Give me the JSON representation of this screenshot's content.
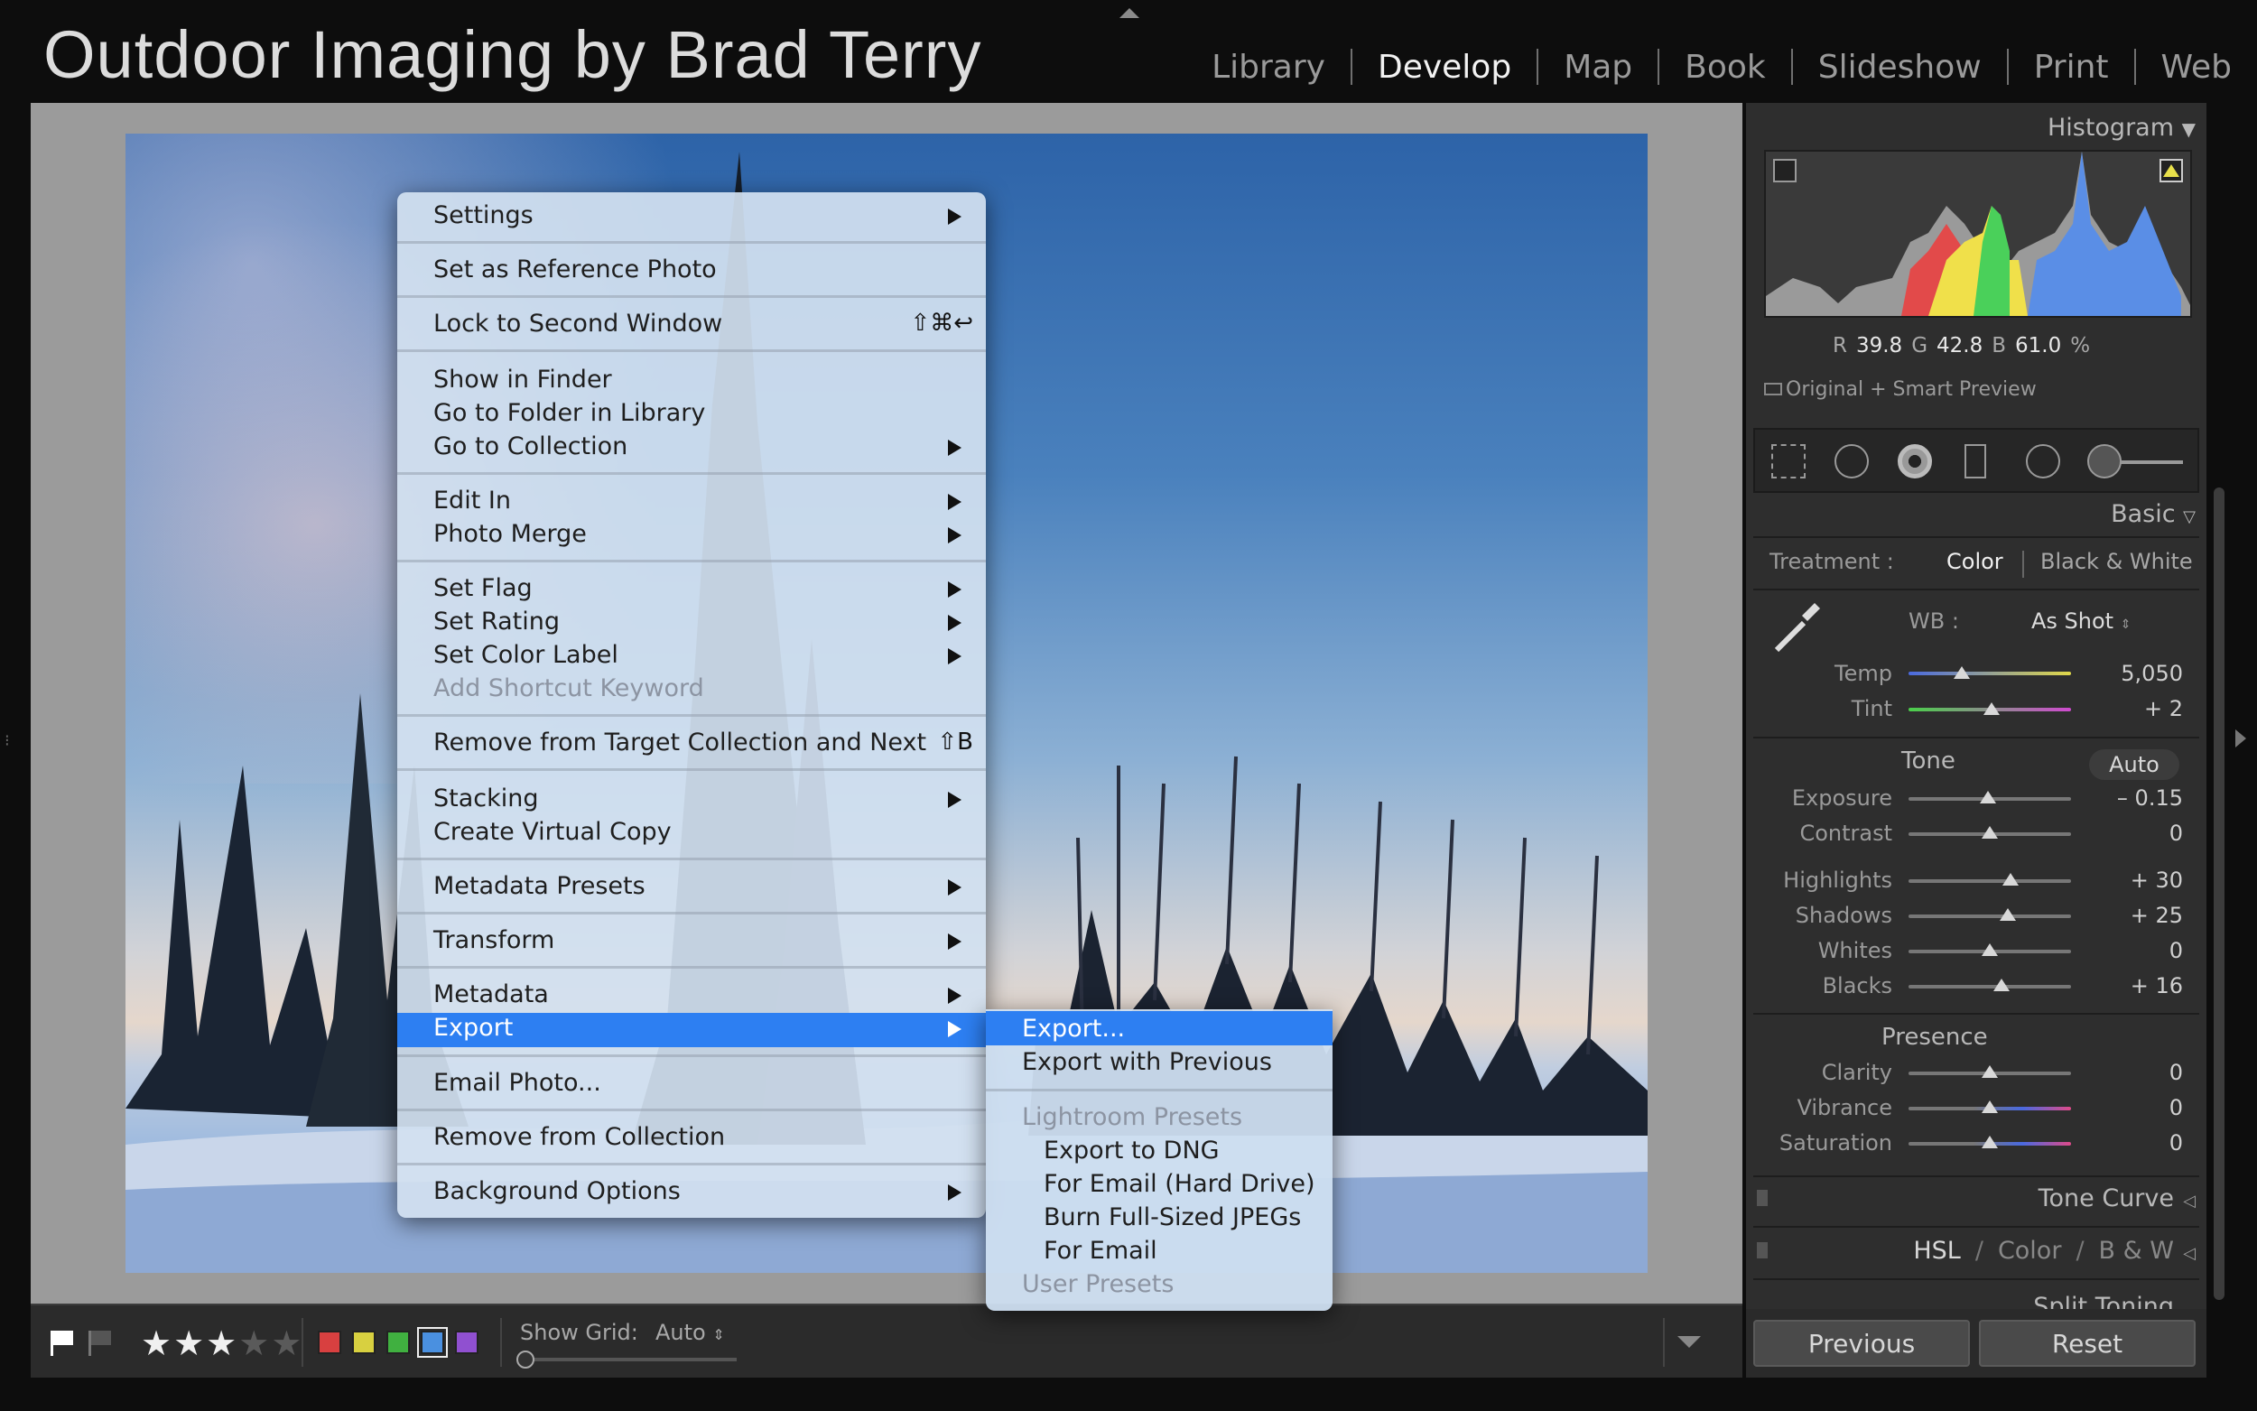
{
  "identity_plate": "Outdoor Imaging by Brad Terry",
  "modules": [
    "Library",
    "Develop",
    "Map",
    "Book",
    "Slideshow",
    "Print",
    "Web"
  ],
  "active_module": "Develop",
  "context_menu": {
    "items": [
      "Settings",
      "Set as Reference Photo",
      "Lock to Second Window",
      "Show in Finder",
      "Go to Folder in Library",
      "Go to Collection",
      "Edit In",
      "Photo Merge",
      "Set Flag",
      "Set Rating",
      "Set Color Label",
      "Add Shortcut Keyword",
      "Remove from Target Collection and Next",
      "Stacking",
      "Create Virtual Copy",
      "Metadata Presets",
      "Transform",
      "Metadata",
      "Export",
      "Email Photo...",
      "Remove from Collection",
      "Background Options"
    ],
    "shortcut_lock": "⇧⌘↩",
    "shortcut_remove": "⇧B",
    "highlighted": "Export"
  },
  "export_submenu": {
    "items": [
      "Export...",
      "Export with Previous",
      "Lightroom Presets",
      "Export to DNG",
      "For Email (Hard Drive)",
      "Burn Full-Sized JPEGs",
      "For Email",
      "User Presets"
    ],
    "highlighted": "Export..."
  },
  "histogram": {
    "title": "Histogram",
    "r_label": "R",
    "r_value": "39.8",
    "g_label": "G",
    "g_value": "42.8",
    "b_label": "B",
    "b_value": "61.0",
    "unit": "%",
    "preview_status": "Original + Smart Preview"
  },
  "basic": {
    "title": "Basic",
    "treatment_label": "Treatment :",
    "treatment_color": "Color",
    "treatment_bw": "Black & White",
    "wb_label": "WB :",
    "wb_value": "As Shot",
    "temp_label": "Temp",
    "temp_value": "5,050",
    "temp_pos": 0.33,
    "tint_label": "Tint",
    "tint_value": "+ 2",
    "tint_pos": 0.51,
    "tone_label": "Tone",
    "auto_label": "Auto",
    "sliders": [
      {
        "label": "Exposure",
        "value": "– 0.15",
        "pos": 0.49
      },
      {
        "label": "Contrast",
        "value": "0",
        "pos": 0.5
      },
      {
        "label": "Highlights",
        "value": "+ 30",
        "pos": 0.63
      },
      {
        "label": "Shadows",
        "value": "+ 25",
        "pos": 0.61
      },
      {
        "label": "Whites",
        "value": "0",
        "pos": 0.5
      },
      {
        "label": "Blacks",
        "value": "+ 16",
        "pos": 0.57
      }
    ],
    "presence_label": "Presence",
    "presence": [
      {
        "label": "Clarity",
        "value": "0",
        "pos": 0.5
      },
      {
        "label": "Vibrance",
        "value": "0",
        "pos": 0.5
      },
      {
        "label": "Saturation",
        "value": "0",
        "pos": 0.5
      }
    ]
  },
  "panels": {
    "tone_curve": "Tone Curve",
    "hsl": "HSL",
    "hsl_sep1": "/",
    "color": "Color",
    "hsl_sep2": "/",
    "bw": "B & W",
    "split_toning": "Split Toning"
  },
  "buttons": {
    "previous": "Previous",
    "reset": "Reset"
  },
  "toolbar": {
    "show_grid_label": "Show Grid:",
    "show_grid_value": "Auto",
    "rating": 3,
    "rating_max": 5,
    "color_labels": [
      "#d84040",
      "#d8d040",
      "#40b040",
      "#4a90e0",
      "#9050d0"
    ],
    "selected_color_label": "#4a90e0"
  }
}
